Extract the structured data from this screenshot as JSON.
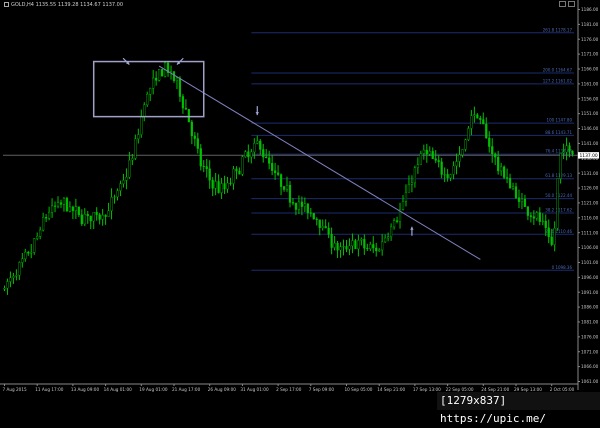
{
  "header": {
    "symbol_line": "GOLD,H4  1135.55 1139.28 1134.67 1137.00"
  },
  "watermark": "[1279x837] https://upic.me/",
  "colors": {
    "background": "#000000",
    "candle_up": "#00c000",
    "candle_down": "#00c000",
    "fib_line": "#1d2c6e",
    "fib_label": "#4a6ab8",
    "trendline": "#8080c0",
    "bid_line": "#606060",
    "box": "#a0a0c8",
    "arrow": "#a0a8d8",
    "axis_text": "#c8c8c8",
    "price_box_bg": "#ffffff",
    "price_box_fg": "#000000"
  },
  "chart_data": {
    "type": "candlestick",
    "y_axis": {
      "side": "right",
      "ylim": [
        1061.5,
        1186.5
      ],
      "tick_values": [
        1186.0,
        1181.0,
        1176.0,
        1171.0,
        1166.0,
        1161.0,
        1156.0,
        1151.0,
        1146.0,
        1141.0,
        1136.0,
        1131.0,
        1126.0,
        1121.0,
        1116.0,
        1111.0,
        1106.0,
        1101.0,
        1096.0,
        1091.0,
        1086.0,
        1081.0,
        1076.0,
        1071.0,
        1066.0,
        1061.0
      ],
      "tick_labels": [
        "1186.00",
        "1181.00",
        "1176.00",
        "1171.00",
        "1166.00",
        "1161.00",
        "1156.00",
        "1151.00",
        "1146.00",
        "1141.00",
        "1136.00",
        "1131.00",
        "1126.00",
        "1121.00",
        "1116.00",
        "1111.00",
        "1106.00",
        "1101.00",
        "1096.00",
        "1091.00",
        "1086.00",
        "1081.00",
        "1076.00",
        "1071.00",
        "1066.00",
        "1061.00"
      ]
    },
    "current_price": 1137.0,
    "current_price_label": "1137.00",
    "x_axis": {
      "tick_labels": [
        "7 Aug 2015",
        "11 Aug 17:00",
        "13 Aug 09:00",
        "14 Aug 01:00",
        "19 Aug 01:00",
        "21 Aug 17:00",
        "26 Aug 09:00",
        "31 Aug 01:00",
        "2 Sep 17:00",
        "7 Sep 09:00",
        "10 Sep 05:00",
        "14 Sep 21:00",
        "17 Sep 13:00",
        "22 Sep 05:00",
        "24 Sep 21:00",
        "29 Sep 13:00",
        "2 Oct 05:00"
      ],
      "tick_index": [
        0,
        11,
        23,
        34,
        46,
        57,
        69,
        80,
        92,
        103,
        115,
        126,
        138,
        149,
        161,
        172,
        184
      ]
    },
    "candles_count": 192,
    "price_path": [
      [
        0,
        1092
      ],
      [
        5,
        1098
      ],
      [
        10,
        1106
      ],
      [
        15,
        1118
      ],
      [
        20,
        1121
      ],
      [
        25,
        1117
      ],
      [
        30,
        1116
      ],
      [
        35,
        1118
      ],
      [
        40,
        1127
      ],
      [
        44,
        1138
      ],
      [
        48,
        1157
      ],
      [
        52,
        1163
      ],
      [
        54,
        1167
      ],
      [
        58,
        1162
      ],
      [
        62,
        1151
      ],
      [
        66,
        1135
      ],
      [
        70,
        1128
      ],
      [
        74,
        1125
      ],
      [
        78,
        1131
      ],
      [
        82,
        1137
      ],
      [
        86,
        1141
      ],
      [
        90,
        1133
      ],
      [
        94,
        1126
      ],
      [
        98,
        1122
      ],
      [
        102,
        1118
      ],
      [
        106,
        1116
      ],
      [
        110,
        1109
      ],
      [
        114,
        1104
      ],
      [
        118,
        1108
      ],
      [
        122,
        1106
      ],
      [
        126,
        1105
      ],
      [
        130,
        1113
      ],
      [
        134,
        1119
      ],
      [
        138,
        1131
      ],
      [
        142,
        1139
      ],
      [
        146,
        1133
      ],
      [
        150,
        1131
      ],
      [
        154,
        1137
      ],
      [
        158,
        1152
      ],
      [
        162,
        1145
      ],
      [
        166,
        1134
      ],
      [
        170,
        1128
      ],
      [
        174,
        1121
      ],
      [
        178,
        1118
      ],
      [
        182,
        1113
      ],
      [
        185,
        1105
      ],
      [
        187,
        1136
      ],
      [
        189,
        1139
      ]
    ],
    "fibonacci": {
      "levels": [
        {
          "label": "261.8  1178.17",
          "price": 1178.17
        },
        {
          "label": "200.0  1164.67",
          "price": 1164.67
        },
        {
          "label": "127.2  1161.02",
          "price": 1161.02
        },
        {
          "label": "100  1147.80",
          "price": 1147.8
        },
        {
          "label": "88.6  1143.71",
          "price": 1143.71
        },
        {
          "label": "76.4  1137.40",
          "price": 1137.4
        },
        {
          "label": "61.8  1129.13",
          "price": 1129.13
        },
        {
          "label": "50.0  1122.44",
          "price": 1122.44
        },
        {
          "label": "38.2  1117.62",
          "price": 1117.62
        },
        {
          "label": "23.6  1110.46",
          "price": 1110.46
        },
        {
          "label": "0  1098.36",
          "price": 1098.36
        }
      ],
      "start_index": 83
    },
    "trendline": {
      "from": [
        52,
        1167
      ],
      "to": [
        160,
        1102
      ]
    },
    "highlight_box": {
      "from_index": 30,
      "to_index": 67,
      "price_top": 1168.5,
      "price_bottom": 1150.0
    },
    "arrows": [
      {
        "direction": "down-right",
        "index": 42,
        "price": 1167.5
      },
      {
        "direction": "down-left",
        "index": 58,
        "price": 1167.5
      },
      {
        "direction": "down",
        "index": 85,
        "price": 1150.5
      },
      {
        "direction": "up",
        "index": 137,
        "price": 1113.0
      }
    ]
  }
}
